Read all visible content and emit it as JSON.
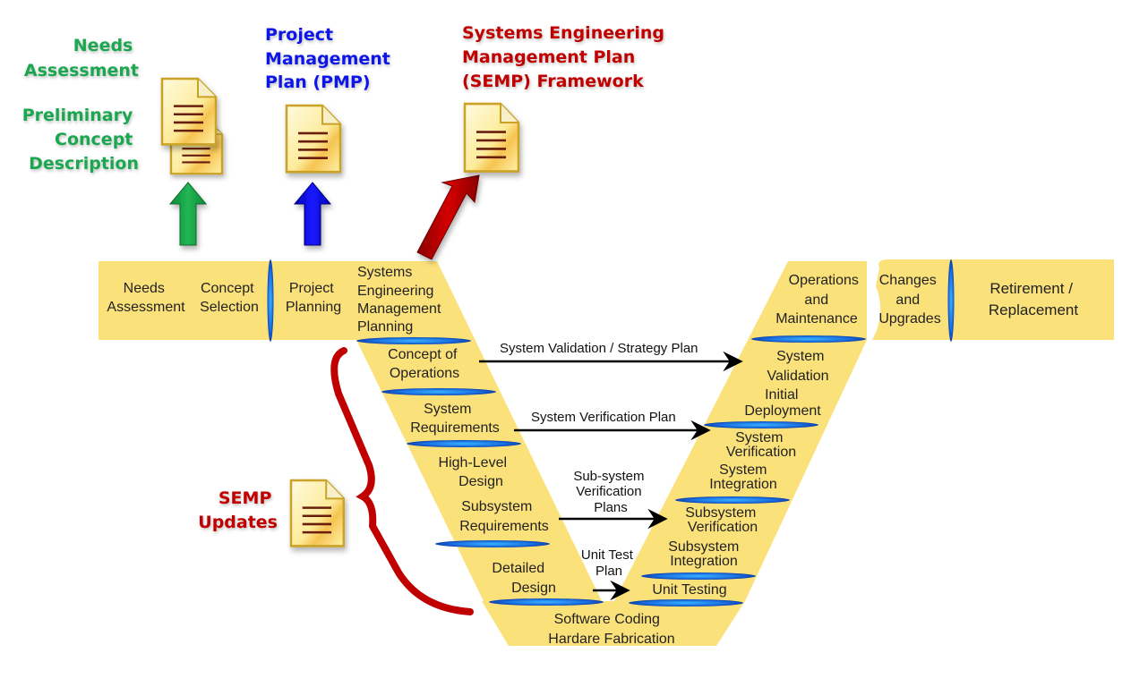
{
  "colors": {
    "band": "#fbe17a",
    "band_edge": "#f3d25a",
    "divider": "#1e6fd9",
    "green": "#1aa64f",
    "blue": "#0a14e6",
    "red": "#c00000",
    "doc_fill": "#fbe98c",
    "doc_line": "#6b1f0f",
    "doc_border": "#c9a227"
  },
  "top_headings": {
    "needs_assessment": [
      "Needs",
      "Assessment"
    ],
    "preliminary_concept": [
      "Preliminary",
      "Concept",
      "Description"
    ],
    "pmp": [
      "Project",
      "Management",
      "Plan (PMP)"
    ],
    "semp_framework": [
      "Systems Engineering",
      "Management Plan",
      "(SEMP) Framework"
    ]
  },
  "semp_updates": [
    "SEMP",
    "Updates"
  ],
  "top_band": {
    "needs_assessment": [
      "Needs",
      "Assessment"
    ],
    "concept_selection": [
      "Concept",
      "Selection"
    ],
    "project_planning": [
      "Project",
      "Planning"
    ],
    "semp_planning": [
      "Systems",
      "Engineering",
      "Management",
      "Planning"
    ],
    "operations_maintenance": [
      "Operations",
      "and",
      "Maintenance"
    ],
    "changes_upgrades": [
      "Changes",
      "and",
      "Upgrades"
    ],
    "retirement": [
      "Retirement /",
      "Replacement"
    ]
  },
  "left_leg": {
    "concept_of_operations": [
      "Concept of",
      "Operations"
    ],
    "system_requirements": [
      "System",
      "Requirements"
    ],
    "high_level_design": [
      "High-Level",
      "Design"
    ],
    "subsystem_requirements": [
      "Subsystem",
      "Requirements"
    ],
    "detailed_design": [
      "Detailed",
      "Design"
    ]
  },
  "bottom": [
    "Software Coding",
    "Hardare Fabrication"
  ],
  "right_leg": {
    "system_validation": [
      "System",
      "Validation"
    ],
    "initial_deployment": [
      "Initial",
      "Deployment"
    ],
    "system_verification": [
      "System",
      "Verification"
    ],
    "system_integration": [
      "System",
      "Integration"
    ],
    "subsystem_verification": [
      "Subsystem",
      "Verification"
    ],
    "subsystem_integration": [
      "Subsystem",
      "Integration"
    ],
    "unit_testing": [
      "Unit Testing"
    ]
  },
  "arrows": {
    "validation_plan": "System Validation / Strategy Plan",
    "verification_plan": "System Verification Plan",
    "subsystem_plans": [
      "Sub-system",
      "Verification",
      "Plans"
    ],
    "unit_test_plan": [
      "Unit Test",
      "Plan"
    ]
  },
  "icons": {
    "document": "document-icon",
    "arrow_up": "arrow-up-icon",
    "arrow_diagonal": "arrow-diagonal-icon",
    "brace": "curly-brace-icon"
  }
}
